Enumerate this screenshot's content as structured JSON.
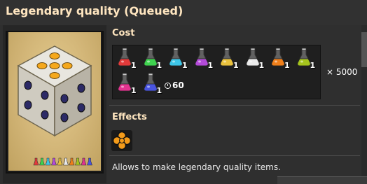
{
  "title": "Legendary quality (Queued)",
  "cost": {
    "label": "Cost",
    "ingredients": [
      {
        "name": "automation-science-pack",
        "color": "#e23a3a",
        "count": "1"
      },
      {
        "name": "logistic-science-pack",
        "color": "#3fd34f",
        "count": "1"
      },
      {
        "name": "chemical-science-pack",
        "color": "#3dc6e8",
        "count": "1"
      },
      {
        "name": "production-science-pack",
        "color": "#b44bd9",
        "count": "1"
      },
      {
        "name": "utility-science-pack",
        "color": "#e9c13d",
        "count": "1"
      },
      {
        "name": "space-science-pack",
        "color": "#eaeaea",
        "count": "1"
      },
      {
        "name": "metallurgic-science-pack",
        "color": "#f07f1a",
        "count": "1"
      },
      {
        "name": "agricultural-science-pack",
        "color": "#a5c41d",
        "count": "1"
      },
      {
        "name": "electromagnetic-science-pack",
        "color": "#e2338f",
        "count": "1"
      },
      {
        "name": "cryogenic-science-pack",
        "color": "#4a55e0",
        "count": "1"
      }
    ],
    "time": "60",
    "multiplier": "× 5000"
  },
  "effects": {
    "label": "Effects",
    "icon": "quality-unlock-icon",
    "description": "Allows to make legendary quality items."
  },
  "colors": {
    "title": "#ffe6c0",
    "accent": "#f39b1a"
  }
}
